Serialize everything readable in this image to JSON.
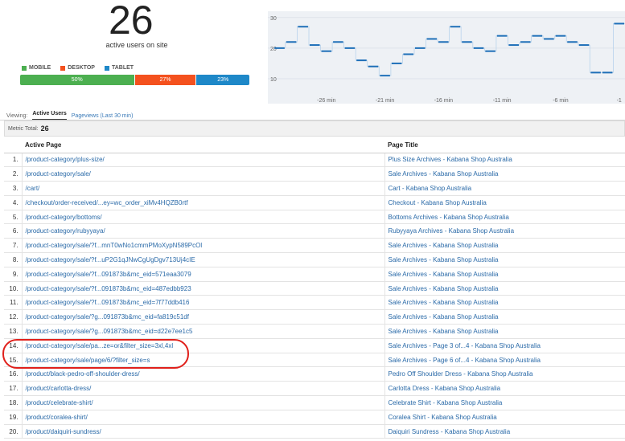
{
  "summary": {
    "active_users": "26",
    "active_label": "active users on site"
  },
  "devices": {
    "legend": [
      {
        "label": "MOBILE",
        "color": "#4caf50"
      },
      {
        "label": "DESKTOP",
        "color": "#f4511e"
      },
      {
        "label": "TABLET",
        "color": "#1e88c8"
      }
    ],
    "split": [
      {
        "label": "50%",
        "value": 50,
        "color": "#4caf50"
      },
      {
        "label": "27%",
        "value": 27,
        "color": "#f4511e"
      },
      {
        "label": "23%",
        "value": 23,
        "color": "#1e88c8"
      }
    ]
  },
  "chart_data": {
    "type": "line",
    "y_ticks": [
      "30",
      "20",
      "10"
    ],
    "ylim": [
      5,
      31
    ],
    "x_tick_labels": [
      "-26 min",
      "-21 min",
      "-16 min",
      "-11 min",
      "-6 min",
      "-1"
    ],
    "x_tick_positions": [
      -26,
      -21,
      -16,
      -11,
      -6,
      -1
    ],
    "xlim": [
      -31,
      -0.5
    ],
    "x": [
      -30,
      -29,
      -28,
      -27,
      -26,
      -25,
      -24,
      -23,
      -22,
      -21,
      -20,
      -19,
      -18,
      -17,
      -16,
      -15,
      -14,
      -13,
      -12,
      -11,
      -10,
      -9,
      -8,
      -7,
      -6,
      -5,
      -4,
      -3,
      -2,
      -1
    ],
    "values": [
      20,
      22,
      27,
      21,
      19,
      22,
      20,
      16,
      14,
      11,
      15,
      18,
      20,
      23,
      22,
      27,
      22,
      20,
      19,
      24,
      21,
      22,
      24,
      23,
      24,
      22,
      21,
      12,
      12,
      28
    ],
    "line_color": "#1e6fb8"
  },
  "viewing": {
    "label": "Viewing:",
    "active_tab": "Active Users",
    "other_tab": "Pageviews (Last 30 min)"
  },
  "metric": {
    "label": "Metric Total:",
    "value": "26"
  },
  "table": {
    "headers": {
      "page": "Active Page",
      "title": "Page Title"
    },
    "rows": [
      {
        "n": "1.",
        "page": "/product-category/plus-size/",
        "title": "Plus Size Archives - Kabana Shop Australia"
      },
      {
        "n": "2.",
        "page": "/product-category/sale/",
        "title": "Sale Archives - Kabana Shop Australia"
      },
      {
        "n": "3.",
        "page": "/cart/",
        "title": "Cart - Kabana Shop Australia"
      },
      {
        "n": "4.",
        "page": "/checkout/order-received/...ey=wc_order_xiMv4HQZB0rtf",
        "title": "Checkout - Kabana Shop Australia"
      },
      {
        "n": "5.",
        "page": "/product-category/bottoms/",
        "title": "Bottoms Archives - Kabana Shop Australia"
      },
      {
        "n": "6.",
        "page": "/product-category/rubyyaya/",
        "title": "Rubyyaya Archives - Kabana Shop Australia"
      },
      {
        "n": "7.",
        "page": "/product-category/sale/?f...mnT0wNo1cmmPMoXypN589PcOl",
        "title": "Sale Archives - Kabana Shop Australia"
      },
      {
        "n": "8.",
        "page": "/product-category/sale/?f...uP2G1qJNwCgUgDgv713Uj4cIE",
        "title": "Sale Archives - Kabana Shop Australia"
      },
      {
        "n": "9.",
        "page": "/product-category/sale/?f...091873b&mc_eid=571eaa3079",
        "title": "Sale Archives - Kabana Shop Australia"
      },
      {
        "n": "10.",
        "page": "/product-category/sale/?f...091873b&mc_eid=487edbb923",
        "title": "Sale Archives - Kabana Shop Australia"
      },
      {
        "n": "11.",
        "page": "/product-category/sale/?f...091873b&mc_eid=7f77ddb416",
        "title": "Sale Archives - Kabana Shop Australia"
      },
      {
        "n": "12.",
        "page": "/product-category/sale/?g...091873b&mc_eid=fa819c51df",
        "title": "Sale Archives - Kabana Shop Australia"
      },
      {
        "n": "13.",
        "page": "/product-category/sale/?g...091873b&mc_eid=d22e7ee1c5",
        "title": "Sale Archives - Kabana Shop Australia"
      },
      {
        "n": "14.",
        "page": "/product-category/sale/pa...ze=or&filter_size=3xl,4xl",
        "title": "Sale Archives - Page 3 of...4 - Kabana Shop Australia"
      },
      {
        "n": "15.",
        "page": "/product-category/sale/page/6/?filter_size=s",
        "title": "Sale Archives - Page 6 of...4 - Kabana Shop Australia"
      },
      {
        "n": "16.",
        "page": "/product/black-pedro-off-shoulder-dress/",
        "title": "Pedro Off Shoulder Dress - Kabana Shop Australia"
      },
      {
        "n": "17.",
        "page": "/product/carlotta-dress/",
        "title": "Carlotta Dress - Kabana Shop Australia"
      },
      {
        "n": "18.",
        "page": "/product/celebrate-shirt/",
        "title": "Celebrate Shirt - Kabana Shop Australia"
      },
      {
        "n": "19.",
        "page": "/product/coralea-shirt/",
        "title": "Coralea Shirt - Kabana Shop Australia"
      },
      {
        "n": "20.",
        "page": "/product/daiquiri-sundress/",
        "title": "Daiquiri Sundress - Kabana Shop Australia"
      }
    ]
  },
  "annotation": {
    "color": "#e0201b",
    "rows": [
      "14.",
      "15."
    ]
  }
}
